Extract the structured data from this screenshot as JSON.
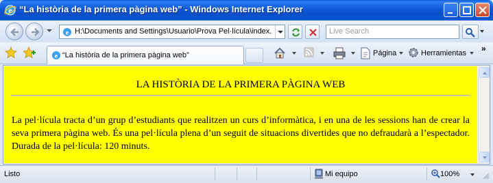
{
  "window": {
    "title": "“La història de la primera pàgina web” - Windows Internet Explorer",
    "minimize": "minimize",
    "maximize": "maximize",
    "close": "close"
  },
  "address_bar": {
    "url": "H:\\Documents and Settings\\Usuario\\Prova Pel·lícula\\index.h",
    "search_placeholder": "Live Search"
  },
  "tab": {
    "label": "“La història de la primera pàgina web”"
  },
  "toolbar": {
    "page_label": "Página",
    "tools_label": "Herramientas",
    "chevrons": "»"
  },
  "page": {
    "heading": "LA HISTÒRIA DE LA PRIMERA PÀGINA WEB",
    "paragraph": "La pel·lícula tracta d’un grup d’estudiants que realitzen un curs d’informàtica, i en una de les sessions han de crear la seva primera pàgina web. És una pel·lícula plena d’un seguit de situacions divertides que no defraudarà a l’espectador. Durada de la pel·lícula: 120 minuts.",
    "background_color": "#ffff00"
  },
  "status_bar": {
    "status": "Listo",
    "zone": "Mi equipo",
    "zoom": "100%"
  },
  "icons": [
    "ie-icon",
    "back-icon",
    "forward-icon",
    "refresh-icon",
    "stop-icon",
    "search-icon",
    "favorites-star-icon",
    "add-favorites-icon",
    "home-icon",
    "feeds-icon",
    "print-icon",
    "page-icon",
    "tools-gear-icon",
    "computer-zone-icon",
    "zoom-icon"
  ]
}
